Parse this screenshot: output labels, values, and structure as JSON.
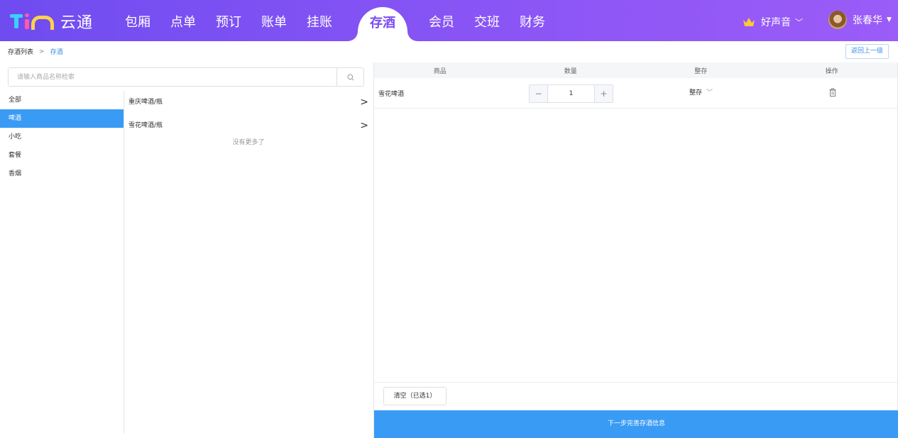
{
  "header": {
    "brand": "云通",
    "nav": [
      "包厢",
      "点单",
      "预订",
      "账单",
      "挂账",
      "存酒",
      "会员",
      "交班",
      "财务"
    ],
    "active_nav": "存酒",
    "store_name": "好声音",
    "user_name": "张春华"
  },
  "breadcrumb": {
    "parent": "存酒列表",
    "sep": ">",
    "current": "存酒"
  },
  "back_button": "返回上一级",
  "search": {
    "placeholder": "请输入商品名称检索"
  },
  "categories": [
    "全部",
    "啤酒",
    "小吃",
    "套餐",
    "香烟"
  ],
  "active_category": "啤酒",
  "products": [
    "重庆啤酒/瓶",
    "雪花啤酒/瓶"
  ],
  "no_more": "没有更多了",
  "table": {
    "headers": [
      "商品",
      "数量",
      "整存",
      "操作"
    ],
    "rows": [
      {
        "name": "雪花啤酒",
        "qty": "1",
        "store_type": "整存"
      }
    ]
  },
  "clear_button": "清空（已选1）",
  "next_button": "下一步完善存酒信息",
  "colors": {
    "accent": "#3a9bf5",
    "brand_gradient_start": "#6f4cf0",
    "brand_gradient_end": "#9b5cf8"
  }
}
